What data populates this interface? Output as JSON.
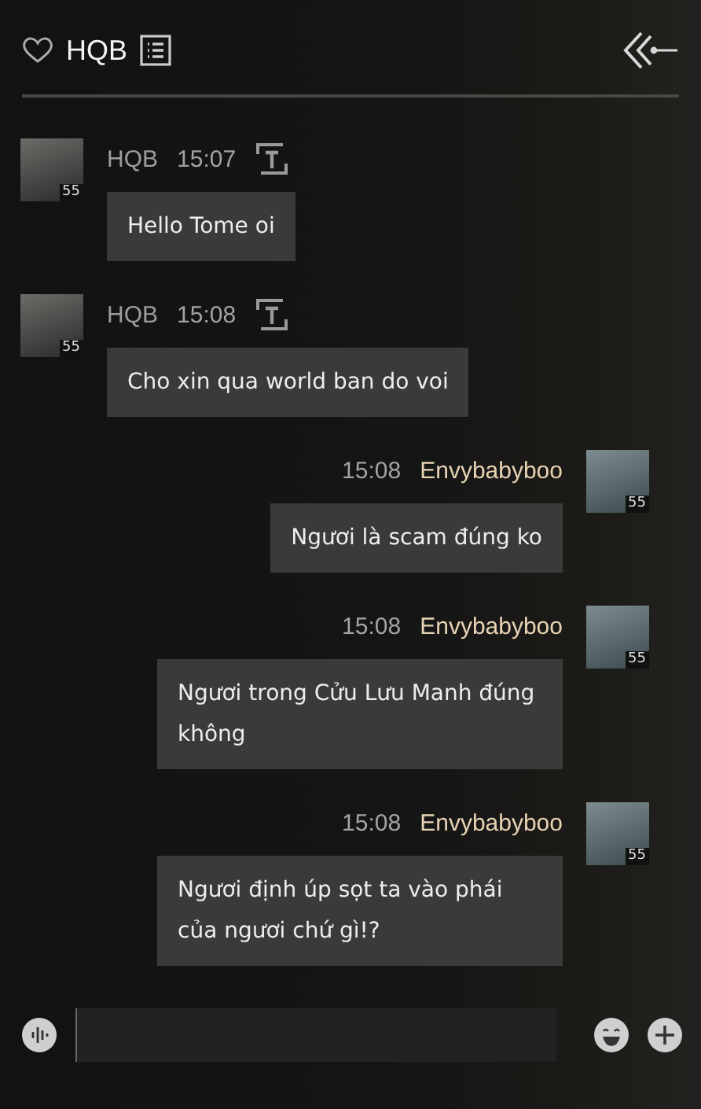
{
  "header": {
    "title": "HQB",
    "favorite": false
  },
  "messages": [
    {
      "kind": "incoming",
      "sender": "HQB",
      "time": "15:07",
      "level_badge": "55",
      "text": "Hello Tome oi"
    },
    {
      "kind": "incoming",
      "sender": "HQB",
      "time": "15:08",
      "level_badge": "55",
      "text": "Cho xin qua world ban do voi"
    },
    {
      "kind": "outgoing",
      "sender": "Envybabyboo",
      "time": "15:08",
      "level_badge": "55",
      "text": "Ngươi là scam đúng ko"
    },
    {
      "kind": "outgoing",
      "sender": "Envybabyboo",
      "time": "15:08",
      "level_badge": "55",
      "text": "Ngươi trong Cửu Lưu Manh đúng không"
    },
    {
      "kind": "outgoing",
      "sender": "Envybabyboo",
      "time": "15:08",
      "level_badge": "55",
      "text": "Ngươi định úp sọt ta vào phái của ngươi chứ gì!?"
    }
  ]
}
